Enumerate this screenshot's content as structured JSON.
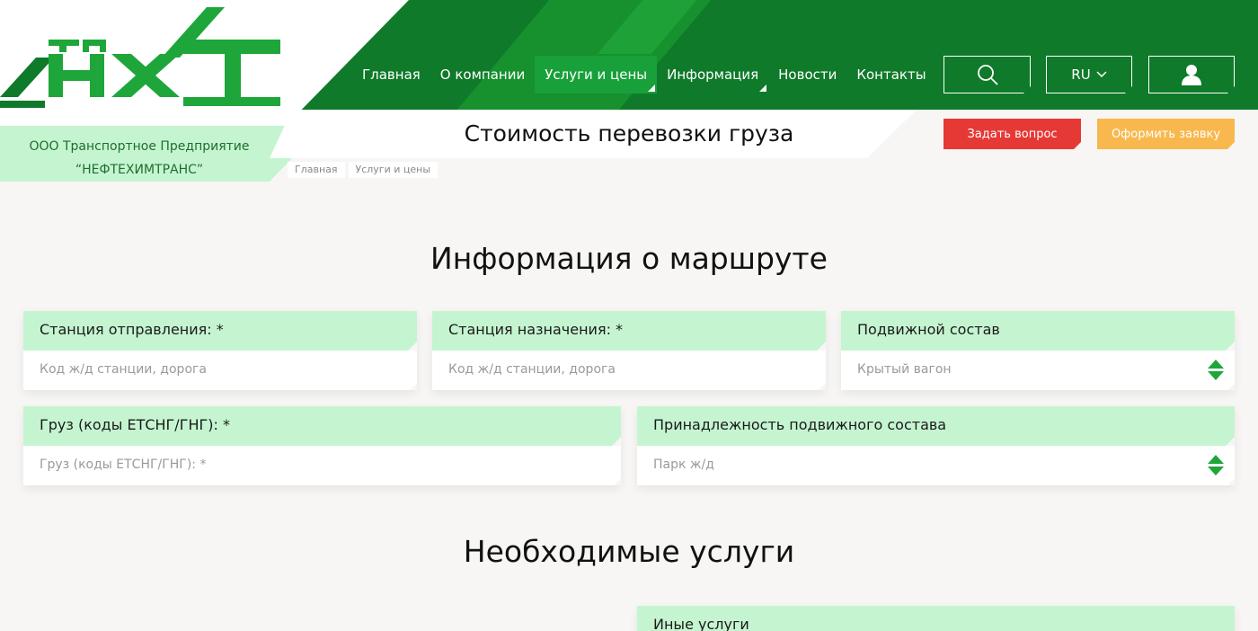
{
  "logo": {
    "top_text": "ТП",
    "mark_text": "НХТ",
    "alt": "logo-ntt"
  },
  "company": {
    "line1": "ООО Транспортное Предприятие",
    "line2": "“НЕФТЕХИМТРАНС”"
  },
  "nav": {
    "items": [
      {
        "label": "Главная"
      },
      {
        "label": "О компании"
      },
      {
        "label": "Услуги и цены",
        "active": true,
        "has_submenu": true
      },
      {
        "label": "Информация",
        "has_submenu": true
      },
      {
        "label": "Новости"
      },
      {
        "label": "Контакты"
      }
    ]
  },
  "header_actions": {
    "search_icon": "search-icon",
    "lang": "RU",
    "user_icon": "user-icon"
  },
  "page": {
    "title": "Стоимость перевозки груза",
    "breadcrumbs": [
      "Главная",
      "Услуги и цены"
    ]
  },
  "buttons": {
    "ask": "Задать вопрос",
    "order": "Оформить заявку"
  },
  "route_section": {
    "title": "Информация о маршруте",
    "fields": [
      {
        "label": "Станция отправления: *",
        "placeholder": "Код ж/д станции, дорога"
      },
      {
        "label": "Станция назначения: *",
        "placeholder": "Код ж/д станции, дорога"
      },
      {
        "label": "Подвижной состав",
        "value": "Крытый вагон"
      },
      {
        "label": "Груз (коды ЕТСНГ/ГНГ): *",
        "placeholder": "Груз (коды ЕТСНГ/ГНГ): *"
      },
      {
        "label": "Принадлежность подвижного состава",
        "value": "Парк ж/д"
      }
    ]
  },
  "services_section": {
    "title": "Необходимые услуги",
    "other_label": "Иные услуги"
  },
  "colors": {
    "header_green": "#0f7a2a",
    "light_green": "#c5f5d0",
    "red": "#e53935",
    "orange": "#f8b84e"
  }
}
